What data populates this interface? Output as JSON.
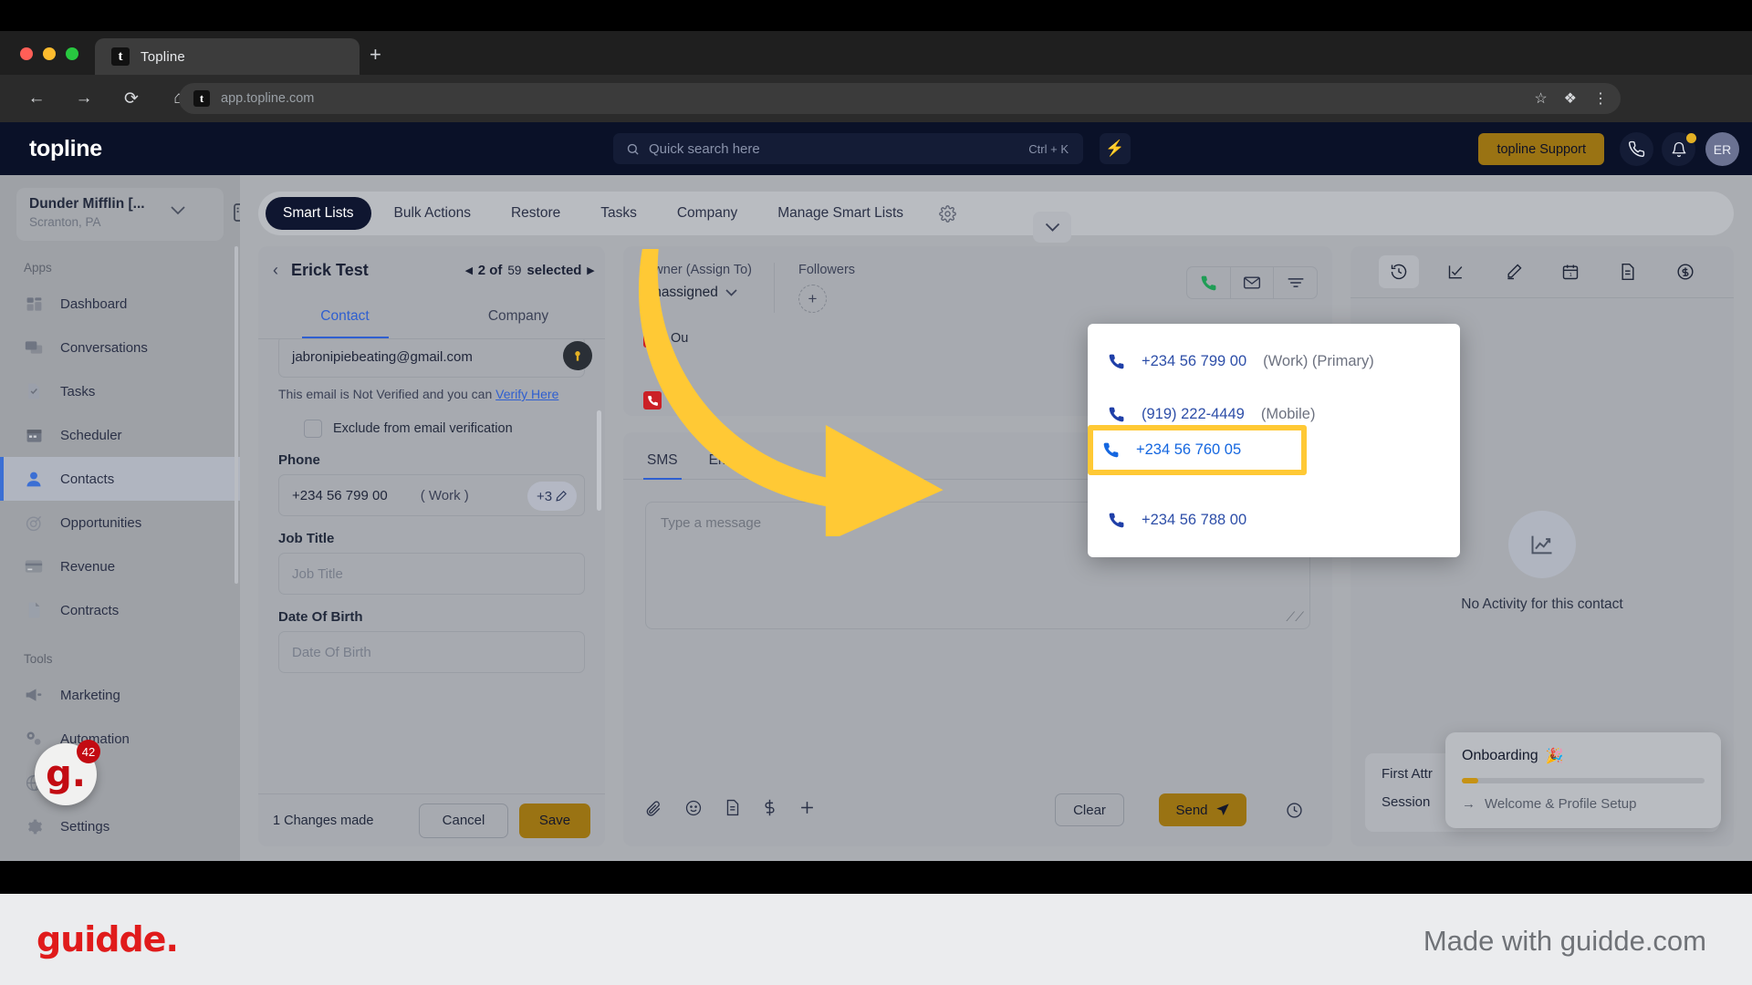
{
  "browser": {
    "tab_title": "Topline",
    "tab_favicon": "t",
    "new_tab_label": "+",
    "url": "app.topline.com",
    "nav": {
      "back": "←",
      "forward": "→",
      "reload": "⟳",
      "home": "⌂"
    },
    "omni_right": {
      "star": "☆",
      "extensions": "❖",
      "menu": "⋮"
    }
  },
  "app_header": {
    "brand": "topline",
    "search_placeholder": "Quick search here",
    "search_shortcut": "Ctrl + K",
    "bolt_icon": "⚡",
    "support_button": "topline Support",
    "avatar_initials": "ER"
  },
  "sidebar": {
    "org_name": "Dunder Mifflin [...",
    "org_location": "Scranton, PA",
    "section_apps": "Apps",
    "section_tools": "Tools",
    "apps": [
      {
        "label": "Dashboard",
        "icon": "dashboard-icon"
      },
      {
        "label": "Conversations",
        "icon": "conversations-icon"
      },
      {
        "label": "Tasks",
        "icon": "tasks-icon"
      },
      {
        "label": "Scheduler",
        "icon": "scheduler-icon"
      },
      {
        "label": "Contacts",
        "icon": "contacts-icon",
        "active": true
      },
      {
        "label": "Opportunities",
        "icon": "opportunities-icon"
      },
      {
        "label": "Revenue",
        "icon": "revenue-icon"
      },
      {
        "label": "Contracts",
        "icon": "contracts-icon"
      }
    ],
    "tools": [
      {
        "label": "Marketing",
        "icon": "marketing-icon"
      },
      {
        "label": "Automation",
        "icon": "automation-icon"
      },
      {
        "label": "Sites",
        "icon": "sites-icon"
      },
      {
        "label": "Settings",
        "icon": "settings-icon"
      }
    ]
  },
  "guidde_widget": {
    "logo": "g.",
    "count": "42"
  },
  "tabbar": {
    "items": [
      {
        "label": "Smart Lists",
        "active": true
      },
      {
        "label": "Bulk Actions"
      },
      {
        "label": "Restore"
      },
      {
        "label": "Tasks"
      },
      {
        "label": "Company"
      },
      {
        "label": "Manage Smart Lists"
      }
    ],
    "gear_icon": "settings-gear-icon"
  },
  "contact_panel": {
    "back_icon": "‹",
    "name": "Erick Test",
    "selection_prev": "◂",
    "selection_text_bold": "2 of",
    "selection_count": "59",
    "selection_text_tail": "selected",
    "selection_next": "▸",
    "tabs": [
      {
        "label": "Contact",
        "active": true
      },
      {
        "label": "Company"
      }
    ],
    "email_value": "jabronipiebeating@gmail.com",
    "email_note_prefix": "This email is Not Verified and you can ",
    "email_note_link": "Verify Here",
    "exclude_checkbox_label": "Exclude from email verification",
    "phone_label": "Phone",
    "phone_value": "+234 56 799 00",
    "phone_type": "( Work )",
    "phone_more": "+3",
    "job_title_label": "Job Title",
    "job_title_placeholder": "Job Title",
    "dob_label": "Date Of Birth",
    "dob_placeholder": "Date Of Birth",
    "changes_text": "1 Changes made",
    "cancel_label": "Cancel",
    "save_label": "Save"
  },
  "mid_panel": {
    "owner_label": "Owner (Assign To)",
    "owner_value": "Unassigned",
    "followers_label": "Followers",
    "followers_add": "+",
    "outbound_rows": [
      "Ou",
      "Ou"
    ],
    "sms_tabs": [
      {
        "label": "SMS",
        "active": true
      },
      {
        "label": "Email"
      }
    ],
    "message_placeholder": "Type a message",
    "toolbar_icons": [
      "attachment-icon",
      "emoji-icon",
      "template-icon",
      "payment-icon",
      "add-icon"
    ],
    "clear_label": "Clear",
    "send_label": "Send",
    "schedule_icon": "clock-icon"
  },
  "right_panel": {
    "action_icons": [
      "activity-icon",
      "task-icon",
      "note-icon",
      "appointment-icon",
      "document-icon",
      "payment-icon"
    ],
    "empty_text": "No Activity for this contact",
    "attribution_rows": [
      "First Attr",
      "Session"
    ]
  },
  "onboarding": {
    "title": "Onboarding",
    "emoji": "🎉",
    "progress_percent": 6,
    "step_arrow": "→",
    "step_label": "Welcome & Profile Setup"
  },
  "phone_dropdown": {
    "items": [
      {
        "number": "+234 56 799 00",
        "tags": "(Work) (Primary)",
        "highlighted": false
      },
      {
        "number": "(919) 222-4449",
        "tags": "(Mobile)",
        "highlighted": false
      },
      {
        "number": "+234 56 760 05",
        "tags": "",
        "highlighted": true
      },
      {
        "number": "+234 56 788 00",
        "tags": "",
        "highlighted": false
      }
    ],
    "highlight_color": "#ffc935"
  },
  "footer": {
    "logo": "guidde.",
    "tagline": "Made with guidde.com",
    "logo_color": "#e01b1b"
  }
}
